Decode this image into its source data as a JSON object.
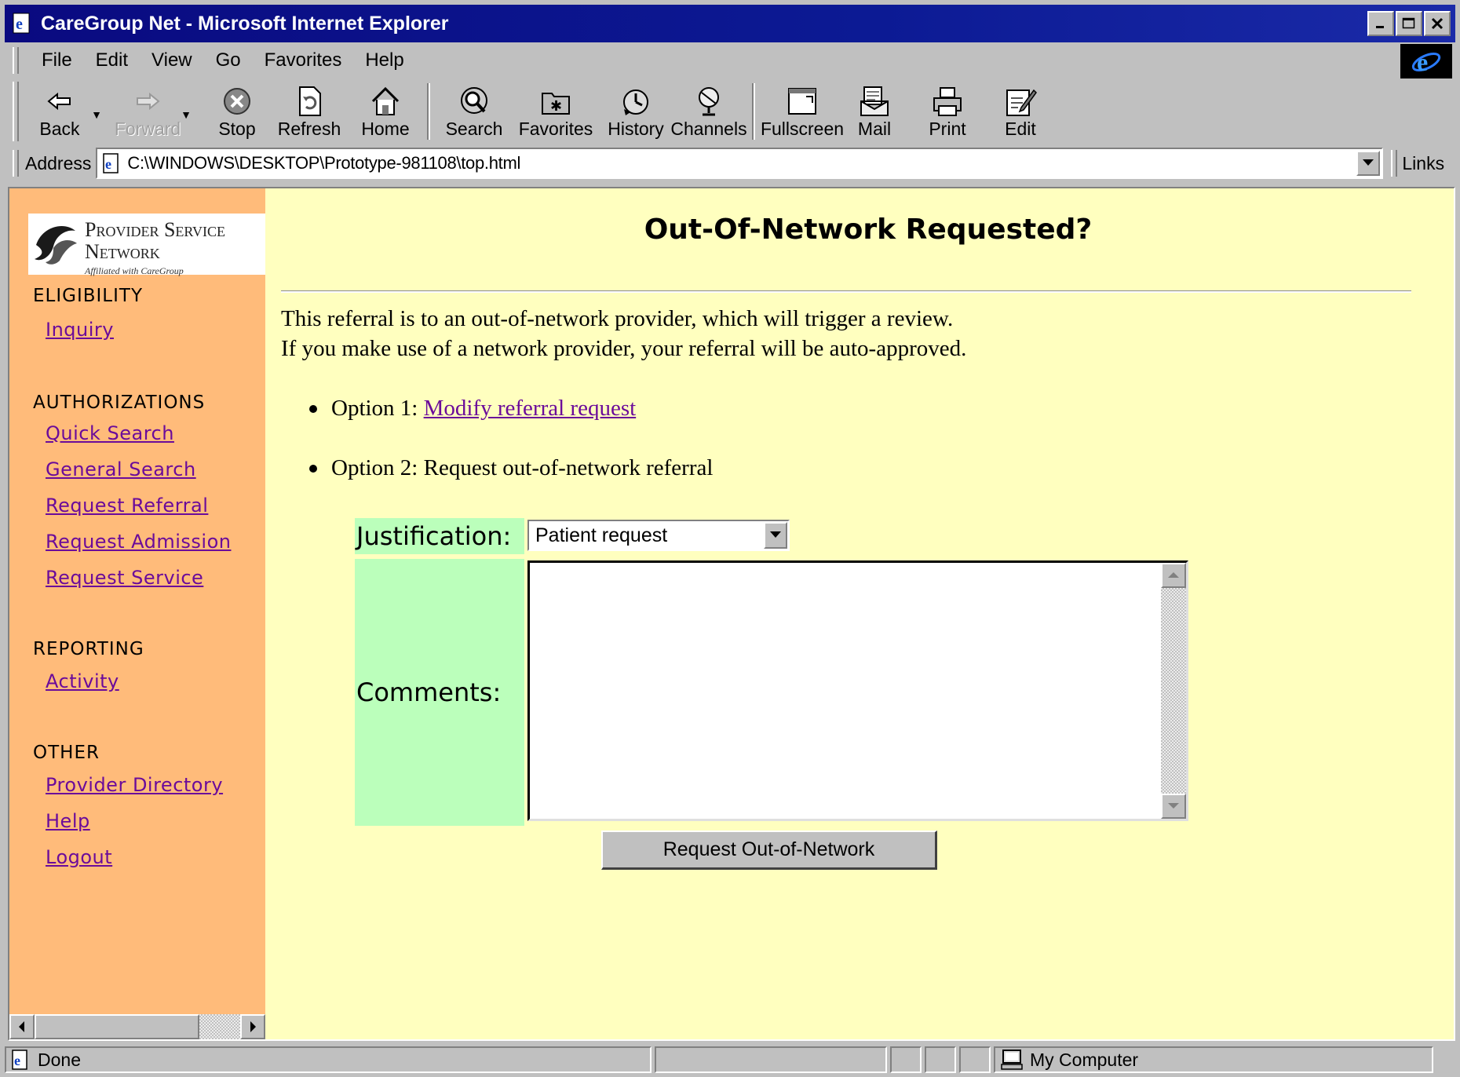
{
  "window": {
    "title": "CareGroup Net - Microsoft Internet Explorer"
  },
  "menu": [
    "File",
    "Edit",
    "View",
    "Go",
    "Favorites",
    "Help"
  ],
  "toolbar": {
    "back": "Back",
    "forward": "Forward",
    "stop": "Stop",
    "refresh": "Refresh",
    "home": "Home",
    "search": "Search",
    "favorites": "Favorites",
    "history": "History",
    "channels": "Channels",
    "fullscreen": "Fullscreen",
    "mail": "Mail",
    "print": "Print",
    "edit": "Edit"
  },
  "address": {
    "label": "Address",
    "url": "C:\\WINDOWS\\DESKTOP\\Prototype-981108\\top.html",
    "links": "Links"
  },
  "sidebar": {
    "logo": {
      "line1": "Provider Service",
      "line2": "Network",
      "line3": "Affiliated with CareGroup"
    },
    "sections": [
      {
        "heading": "ELIGIBILITY",
        "links": [
          "Inquiry"
        ]
      },
      {
        "heading": "AUTHORIZATIONS",
        "links": [
          "Quick Search",
          "General Search",
          "Request Referral",
          "Request Admission",
          "Request Service"
        ]
      },
      {
        "heading": "REPORTING",
        "links": [
          "Activity"
        ]
      },
      {
        "heading": "OTHER",
        "links": [
          "Provider Directory",
          "Help",
          "Logout"
        ]
      }
    ]
  },
  "main": {
    "title": "Out-Of-Network Requested?",
    "line1": "This referral is to an out-of-network provider, which will trigger a review.",
    "line2": "If you make use of a network provider, your referral will be auto-approved.",
    "option1_prefix": "Option 1: ",
    "option1_link": "Modify referral request",
    "option2": "Option 2: Request out-of-network referral",
    "justification_label": "Justification:",
    "justification_value": "Patient request",
    "comments_label": "Comments:",
    "comments_value": "",
    "submit_label": "Request Out-of-Network"
  },
  "status": {
    "text": "Done",
    "zone": "My Computer"
  },
  "colors": {
    "sidebar_bg": "#ffbb7a",
    "main_bg": "#ffffbf",
    "label_bg": "#bbffbb",
    "link": "#6b0b9a",
    "titlebar": "#0a0a80"
  }
}
